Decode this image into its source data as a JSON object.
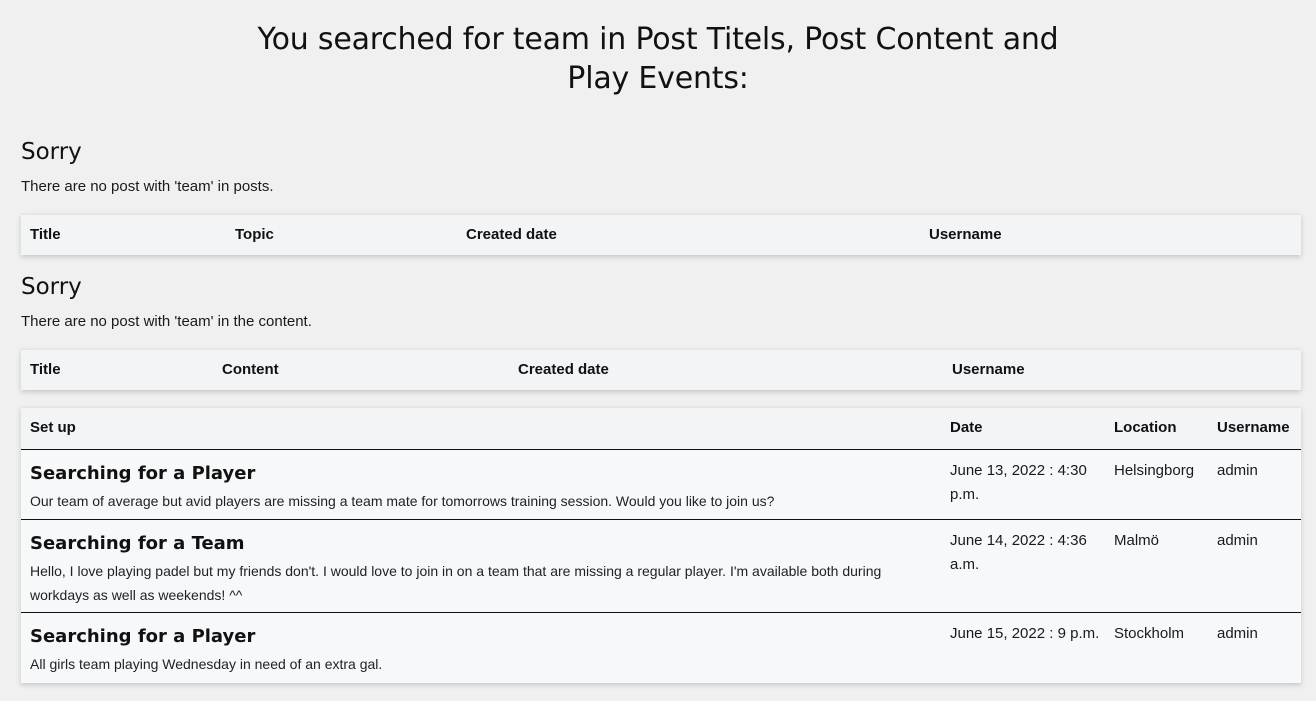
{
  "page": {
    "title_line1": "You searched for team in Post Titels, Post Content and",
    "title_line2": "Play Events:"
  },
  "posts_section": {
    "heading": "Sorry",
    "message": "There are no post with 'team' in posts.",
    "columns": [
      "Title",
      "Topic",
      "Created date",
      "Username"
    ]
  },
  "content_section": {
    "heading": "Sorry",
    "message": "There are no post with 'team' in the content.",
    "columns": [
      "Title",
      "Content",
      "Created date",
      "Username"
    ]
  },
  "events_section": {
    "columns": [
      "Set up",
      "Date",
      "Location",
      "Username"
    ],
    "rows": [
      {
        "title": "Searching for a Player",
        "content": "Our team of average but avid players are missing a team mate for tomorrows training session. Would you like to join us?",
        "date": "June 13, 2022 : 4:30 p.m.",
        "location": "Helsingborg",
        "username": "admin"
      },
      {
        "title": "Searching for a Team",
        "content": "Hello, I love playing padel but my friends don't. I would love to join in on a team that are missing a regular player. I'm available both during workdays as well as weekends! ^^",
        "date": "June 14, 2022 : 4:36 a.m.",
        "location": "Malmö",
        "username": "admin"
      },
      {
        "title": "Searching for a Player",
        "content": "All girls team playing Wednesday in need of an extra gal.",
        "date": "June 15, 2022 : 9 p.m.",
        "location": "Stockholm",
        "username": "admin"
      }
    ]
  }
}
